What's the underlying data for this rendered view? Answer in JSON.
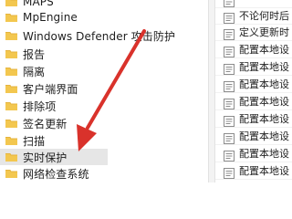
{
  "window": {
    "tree_items": [
      {
        "label": "MAPS"
      },
      {
        "label": "MpEngine"
      },
      {
        "label": "Windows Defender 攻击防护"
      },
      {
        "label": "报告"
      },
      {
        "label": "隔离"
      },
      {
        "label": "客户端界面"
      },
      {
        "label": "排除项"
      },
      {
        "label": "签名更新"
      },
      {
        "label": "扫描"
      },
      {
        "label": "实时保护"
      },
      {
        "label": "网络检查系统"
      }
    ],
    "settings_items": [
      {
        "label": ""
      },
      {
        "label": "不论何时后"
      },
      {
        "label": "定义更新时"
      },
      {
        "label": "配置本地设"
      },
      {
        "label": "配置本地设"
      },
      {
        "label": "配置本地设"
      },
      {
        "label": "配置本地设"
      },
      {
        "label": "配置本地设"
      },
      {
        "label": "配置本地设"
      },
      {
        "label": "配置本地设"
      },
      {
        "label": "配置本地设"
      }
    ]
  },
  "colors": {
    "folder_fill": "#f3c74f",
    "folder_tab": "#e5b33d",
    "arrow": "#d9322b",
    "selection": "#e6e6e6"
  },
  "icons": {
    "tree_item_icon": "folder-icon",
    "setting_icon": "policy-setting-icon",
    "annotation_arrow": "red-arrow-icon"
  }
}
